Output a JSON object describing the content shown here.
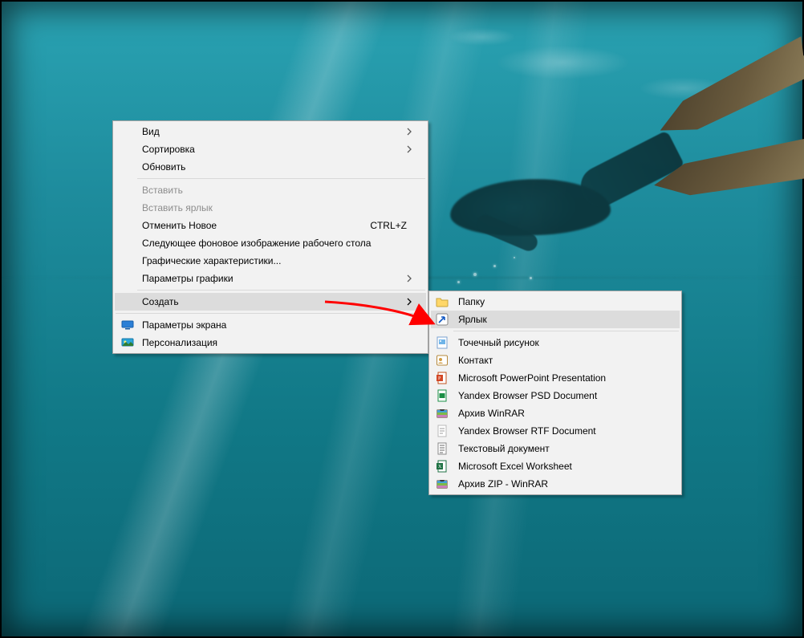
{
  "menu_main": {
    "items": [
      {
        "label": "Вид",
        "submenu": true
      },
      {
        "label": "Сортировка",
        "submenu": true
      },
      {
        "label": "Обновить"
      }
    ],
    "items2": [
      {
        "label": "Вставить",
        "disabled": true
      },
      {
        "label": "Вставить ярлык",
        "disabled": true
      },
      {
        "label": "Отменить Новое",
        "shortcut": "CTRL+Z"
      },
      {
        "label": "Следующее фоновое изображение рабочего стола"
      },
      {
        "label": "Графические характеристики..."
      },
      {
        "label": "Параметры графики",
        "submenu": true
      }
    ],
    "create": {
      "label": "Создать",
      "submenu": true
    },
    "items3": [
      {
        "label": "Параметры экрана",
        "icon": "display-settings"
      },
      {
        "label": "Персонализация",
        "icon": "personalization"
      }
    ]
  },
  "menu_sub": {
    "items": [
      {
        "label": "Папку",
        "icon": "folder"
      },
      {
        "label": "Ярлык",
        "icon": "shortcut",
        "highlight": true
      },
      {
        "label": "Точечный рисунок",
        "icon": "bmp",
        "sep_before": true
      },
      {
        "label": "Контакт",
        "icon": "contact"
      },
      {
        "label": "Microsoft PowerPoint Presentation",
        "icon": "ppt"
      },
      {
        "label": "Yandex Browser PSD Document",
        "icon": "psd"
      },
      {
        "label": "Архив WinRAR",
        "icon": "rar"
      },
      {
        "label": "Yandex Browser RTF Document",
        "icon": "rtf"
      },
      {
        "label": "Текстовый документ",
        "icon": "txt"
      },
      {
        "label": "Microsoft Excel Worksheet",
        "icon": "xlsx"
      },
      {
        "label": "Архив ZIP - WinRAR",
        "icon": "zip"
      }
    ]
  }
}
